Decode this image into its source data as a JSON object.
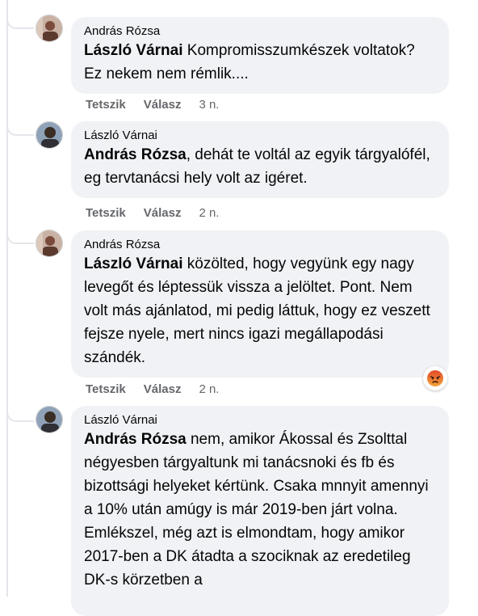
{
  "comments": [
    {
      "author": "András Rózsa",
      "mention": "László Várnai",
      "text": " Kompromisszumkészek voltatok? Ez nekem nem rémlik....",
      "like": "Tetszik",
      "reply": "Válasz",
      "time": "3 n."
    },
    {
      "author": "László Várnai",
      "mention": "András Rózsa",
      "text": ", dehát te voltál az egyik tárgyalófél, eg tervtanácsi hely volt az igéret.",
      "like": "Tetszik",
      "reply": "Válasz",
      "time": "2 n."
    },
    {
      "author": "András Rózsa",
      "mention": "László Várnai",
      "text": " közölted, hogy vegyünk egy nagy levegőt és léptessük vissza a jelöltet. Pont. Nem volt más ajánlatod, mi pedig láttuk, hogy ez veszett fejsze nyele, mert nincs igazi megállapodási szándék.",
      "like": "Tetszik",
      "reply": "Válasz",
      "time": "2 n.",
      "reaction": "angry-reaction-icon"
    },
    {
      "author": "László Várnai",
      "mention": "András Rózsa",
      "text": " nem, amikor Ákossal és Zsolttal négyesben tárgyaltunk mi tanácsnoki és fb és bizottsági helyeket kértünk. Csaka mnnyit amennyi a 10% után amúgy is már 2019-ben járt volna. Emlékszel, még azt is elmondtam, hogy amikor 2017-ben a DK átadta a szociknak az eredetileg DK-s körzetben a"
    }
  ],
  "colors": {
    "bubble": "#f0f2f5",
    "meta": "#65676b",
    "angry_emoji": "#e9710f"
  }
}
